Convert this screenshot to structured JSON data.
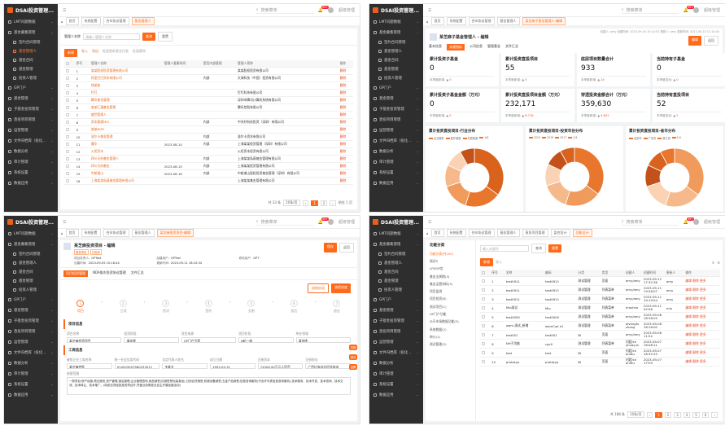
{
  "app": {
    "title": "DSAI投资管理...",
    "search_placeholder": "搜索菜单",
    "notify_count": "99+",
    "user": "超级管理"
  },
  "colors": {
    "accent": "#ff6a1a",
    "sidebar": "#2e2e2e"
  },
  "q1": {
    "menu": [
      "LMT问题数据",
      "基金募集管理",
      "签约合同管理",
      "基金管理人",
      "基金合同",
      "基金管理",
      "投资人管理",
      "GP门户",
      "基金管理",
      "子基金投资管理",
      "直投项目管理",
      "运营管理",
      "文件归档库（投化...",
      "数据分析",
      "审计管理",
      "系统设置",
      "数据应用"
    ],
    "menu_active": "基金管理人",
    "tabs": [
      "首页",
      "系统配置",
      "合伙协议管理",
      "基金管理人"
    ],
    "search_label": "管理人名称",
    "search_placeholder": "请输入管理人名称",
    "query": "查询",
    "reset": "重置",
    "toolbar": [
      "新增",
      "导入",
      "导出",
      "批量更新基金托管",
      "批量删除"
    ],
    "columns": [
      "",
      "序号",
      "管理人名称",
      "管理人备案时间",
      "是否内部管理",
      "管理人简称",
      "操作"
    ],
    "rows": [
      [
        "1",
        "某某股权投资管理有限公司",
        "",
        "",
        "某某股权投资有限公司",
        "删除"
      ],
      [
        "2",
        "阿里巴巴资本有限公司",
        "",
        "内部",
        "天津科技（中国）投资有限公司",
        "删除"
      ],
      [
        "3",
        "钱某某",
        "",
        "",
        "",
        "删除"
      ],
      [
        "4",
        "钉钉",
        "",
        "",
        "钉钉科技有限公司",
        "删除"
      ],
      [
        "5",
        "腾讯基金管理",
        "",
        "",
        "深圳市腾讯计算机系统有限公司",
        "删除"
      ],
      [
        "6",
        "某某汇通基金管理",
        "",
        "",
        "腾讯控股有限公司",
        "删除"
      ],
      [
        "7",
        "盛世管理人",
        "",
        "",
        "",
        "删除"
      ],
      [
        "8",
        "资本管理MSI",
        "",
        "内部",
        "中关村科技投资（深圳）有限公司",
        "删除"
      ],
      [
        "9",
        "某某NMS",
        "",
        "",
        "",
        "删除"
      ],
      [
        "10",
        "慧尔卡基金管理",
        "",
        "内部",
        "慧尔卡资本有限公司",
        "删除"
      ],
      [
        "11",
        "曹华",
        "2023-08-14",
        "内部",
        "上海某某投资管理（深圳）有限公司",
        "删除"
      ],
      [
        "12",
        "火炬资本",
        "",
        "",
        "火炬资本投资有限公司",
        "删除"
      ],
      [
        "13",
        "四川天府基金管理人",
        "",
        "内部",
        "上海某某私募基金管理有限公司",
        "删除"
      ],
      [
        "14",
        "四川天府基金",
        "2023-08-15",
        "内部",
        "上海某某投资管理有限公司",
        "删除"
      ],
      [
        "15",
        "中航湘山",
        "2023-08-16",
        "内部",
        "中航湘山股权投资基金管理（深圳）有限公司",
        "删除"
      ],
      [
        "16",
        "上海某某私募基金管理有限公司",
        "",
        "",
        "上海某某基金管理有限公司",
        "删除"
      ]
    ],
    "pager": {
      "total": "共 33 条",
      "size": "20条/页",
      "pages": [
        "1",
        "2"
      ],
      "goto": "前往 1 页"
    }
  },
  "q2": {
    "tabs": [
      "首页",
      "系统配置",
      "合伙协议管理",
      "基金管理人",
      "某芝麻子基金管理人-编辑"
    ],
    "meta": "创建人: amy  创建时间: 2023-09-04 10:10:52  更新人: amy  更新时间: 2023-09-10 11:14:00",
    "title": "某芝麻子基金管理人 - 编辑",
    "actions": [
      "编辑",
      "返回"
    ],
    "subtabs": [
      "基本信息",
      "关键指标",
      "公司信息",
      "管理基金",
      "文件汇总"
    ],
    "stats": [
      {
        "t": "累计投资子基金",
        "v": "0",
        "s": "本季度新增:",
        "d": "0"
      },
      {
        "t": "累计投资直投项目",
        "v": "55",
        "s": "本季度新增:",
        "d": "5"
      },
      {
        "t": "底层项目数量合计",
        "v": "933",
        "s": "本季度新增:",
        "d": "24"
      },
      {
        "t": "当前持有子基金",
        "v": "0",
        "s": "本季度变动:",
        "d": "0"
      },
      {
        "t": "累计投资子基金金额（万元）",
        "v": "0",
        "s": "本季度新增:",
        "d": "0"
      },
      {
        "t": "累计投资直投项目金额（万元）",
        "v": "232,171",
        "s": "本季度新增:",
        "d": "6,718"
      },
      {
        "t": "穿透投资金额合计（万元）",
        "v": "359,630",
        "s": "本季度新增:",
        "d": "4,841"
      },
      {
        "t": "当前持有直投项目",
        "v": "52",
        "s": "本季度变动:",
        "d": "2"
      }
    ],
    "pies": [
      "累计投资直投项目-行业分布",
      "累计投资直投项目-投资年份分布",
      "累计投资直投项目-省市分布"
    ],
    "pie_legends": [
      [
        "企业服务",
        "医疗健康",
        "先进制造",
        "1/6"
      ],
      [
        "2015",
        "2016",
        "2017",
        "1/4"
      ],
      [
        "北京市",
        "广东省",
        "浙江省",
        "1/4"
      ]
    ]
  },
  "q3": {
    "tabs": [
      "首页",
      "系统配置",
      "合伙协议管理",
      "基金管理人",
      "某芝麻投资项目-编辑"
    ],
    "title": "某芝麻投资项目 - 编辑",
    "tags": [
      "直投项目",
      "已投资"
    ],
    "info": [
      [
        "项目负责人:",
        "GPTest"
      ],
      [
        "创建用户:",
        "GPTest"
      ],
      [
        "修改用户:",
        "GPT"
      ],
      [
        "创建时间:",
        "2023-09-05 10:18:44"
      ],
      [
        "更新时间:",
        "2023-09-11 18:10:34"
      ]
    ],
    "actions": [
      "保存",
      "返回"
    ],
    "subtabs": [
      "项目投资管理",
      "NDA股东投资协议管理",
      "文件汇总"
    ],
    "flow_buttons": [
      "流程启动",
      "流程进度"
    ],
    "steps": [
      "项目",
      "立项",
      "投决",
      "签约",
      "交割",
      "投后",
      "退出"
    ],
    "sec1": "项目信息",
    "f1": [
      [
        "项目名称",
        "某芝麻投资项目"
      ],
      [
        "投资阶段",
        "请选择"
      ],
      [
        "项目来源",
        "GP门户引荐"
      ],
      [
        "项目阶段",
        "B轮一级"
      ],
      [
        "所在领域",
        "请选择"
      ]
    ],
    "sec2": "工商信息",
    "f2": [
      [
        "被投企业工商名称",
        "某芝麻控股"
      ],
      [
        "统一社会信用代码",
        "91450300796023301Y"
      ],
      [
        "法定代表人姓名",
        "韦某文"
      ],
      [
        "成立日期",
        "1993-05-31"
      ],
      [
        "注册资本",
        "74306.90万元人民币"
      ],
      [
        "注册地址",
        "广西壮族自治区桂林市"
      ]
    ],
    "desc_label": "经营范围",
    "desc": "一般项目:房产经营,物业服务,资产管理,酒店管理,企业管理咨询,食品销售(仅销售预包装食品),日用百货销售,机械设备销售;五金产品销售;信息咨询服务(不含许可类信息咨询服务);技术服务、技术开发、技术咨询、技术交流、技术转让、技术推广。(除依法须经批准的项目外,凭营业执照依法自主开展经营活动)",
    "float": [
      "日程",
      "提示",
      "设置"
    ]
  },
  "q4": {
    "tabs": [
      "首页",
      "系统配置",
      "合伙协议管理",
      "基金管理人",
      "直投项目管理",
      "监控设计",
      "功能设计"
    ],
    "tree_title": "功能分类",
    "tree": [
      "功能分类(共200)",
      "测试5",
      "LFMGP信",
      "基金全周期(3)",
      "基金运营材料(3)",
      "项目监测",
      "项目投资(8)",
      "测试项目(1)",
      "GP门户功能",
      "公开市场数据功能(3)",
      "系统数据(2)",
      "审计(1)",
      "测试管理(5)"
    ],
    "search_placeholder": "输入关键字",
    "query": "查询",
    "reset": "重置",
    "toolbar": [
      "新增",
      "导入"
    ],
    "columns": [
      "序号",
      "名称",
      "编码",
      "分类",
      "类型",
      "创建人",
      "创建时间",
      "更新人",
      "操作"
    ],
    "rows": [
      [
        "1",
        "test0911",
        "test0911",
        "测试管理",
        "页面",
        "amy/amy",
        "2023-09-12 17:32:36",
        "amy",
        "编辑 删除 更多"
      ],
      [
        "2",
        "test0911",
        "test0911",
        "测试管理",
        "列表菜单",
        "amy/amy",
        "2023-09-11 19:28:07",
        "amy",
        "编辑 删除 更多"
      ],
      [
        "3",
        "test0911",
        "test0911",
        "测试管理",
        "列表菜单",
        "amy/amy",
        "2023-09-11 19:19:54",
        "amy",
        "编辑 删除 更多"
      ],
      [
        "4",
        "Mio测试",
        "Mio",
        "测试管理",
        "列表菜单",
        "mio/mio",
        "2023-09-11 02:58",
        "mio",
        "编辑 删除 更多"
      ],
      [
        "5",
        "test0000",
        "test0000",
        "测试管理",
        "列表菜单",
        "amy/amy",
        "2023-09-08 18:36:03",
        "",
        "编辑 删除 更多"
      ],
      [
        "6",
        "wam-测试_新增",
        "wamCod e1",
        "测试管理",
        "列表菜单",
        "alvengfu zhang",
        "2023-09-08 18:18:00",
        "",
        "编辑 删除 更多"
      ],
      [
        "7",
        "test001",
        "test001",
        "BI",
        "页面",
        "amy/amy",
        "2023-09-08 11:54",
        "",
        "编辑 删除 更多"
      ],
      [
        "8",
        "NH子功能",
        "cgcX",
        "测试管理",
        "列表菜单",
        "刘超/ch yhuayun",
        "2023-09-07 18:08:11",
        "",
        "编辑 删除 更多"
      ],
      [
        "9",
        "test",
        "test",
        "BI",
        "页面",
        "刘超/ch andtu",
        "2023-09-07 18:32:25",
        "",
        "编辑 删除 更多"
      ],
      [
        "10",
        "prototyp",
        "prototyp",
        "BI",
        "页面",
        "刘超/ch andtu",
        "2023-09-07 17:09",
        "",
        "编辑 删除 更多"
      ]
    ],
    "pager": {
      "total": "共 188 条",
      "size": "10条/页",
      "pages": [
        "1",
        "2",
        "3",
        "4",
        "5",
        "6"
      ]
    }
  }
}
